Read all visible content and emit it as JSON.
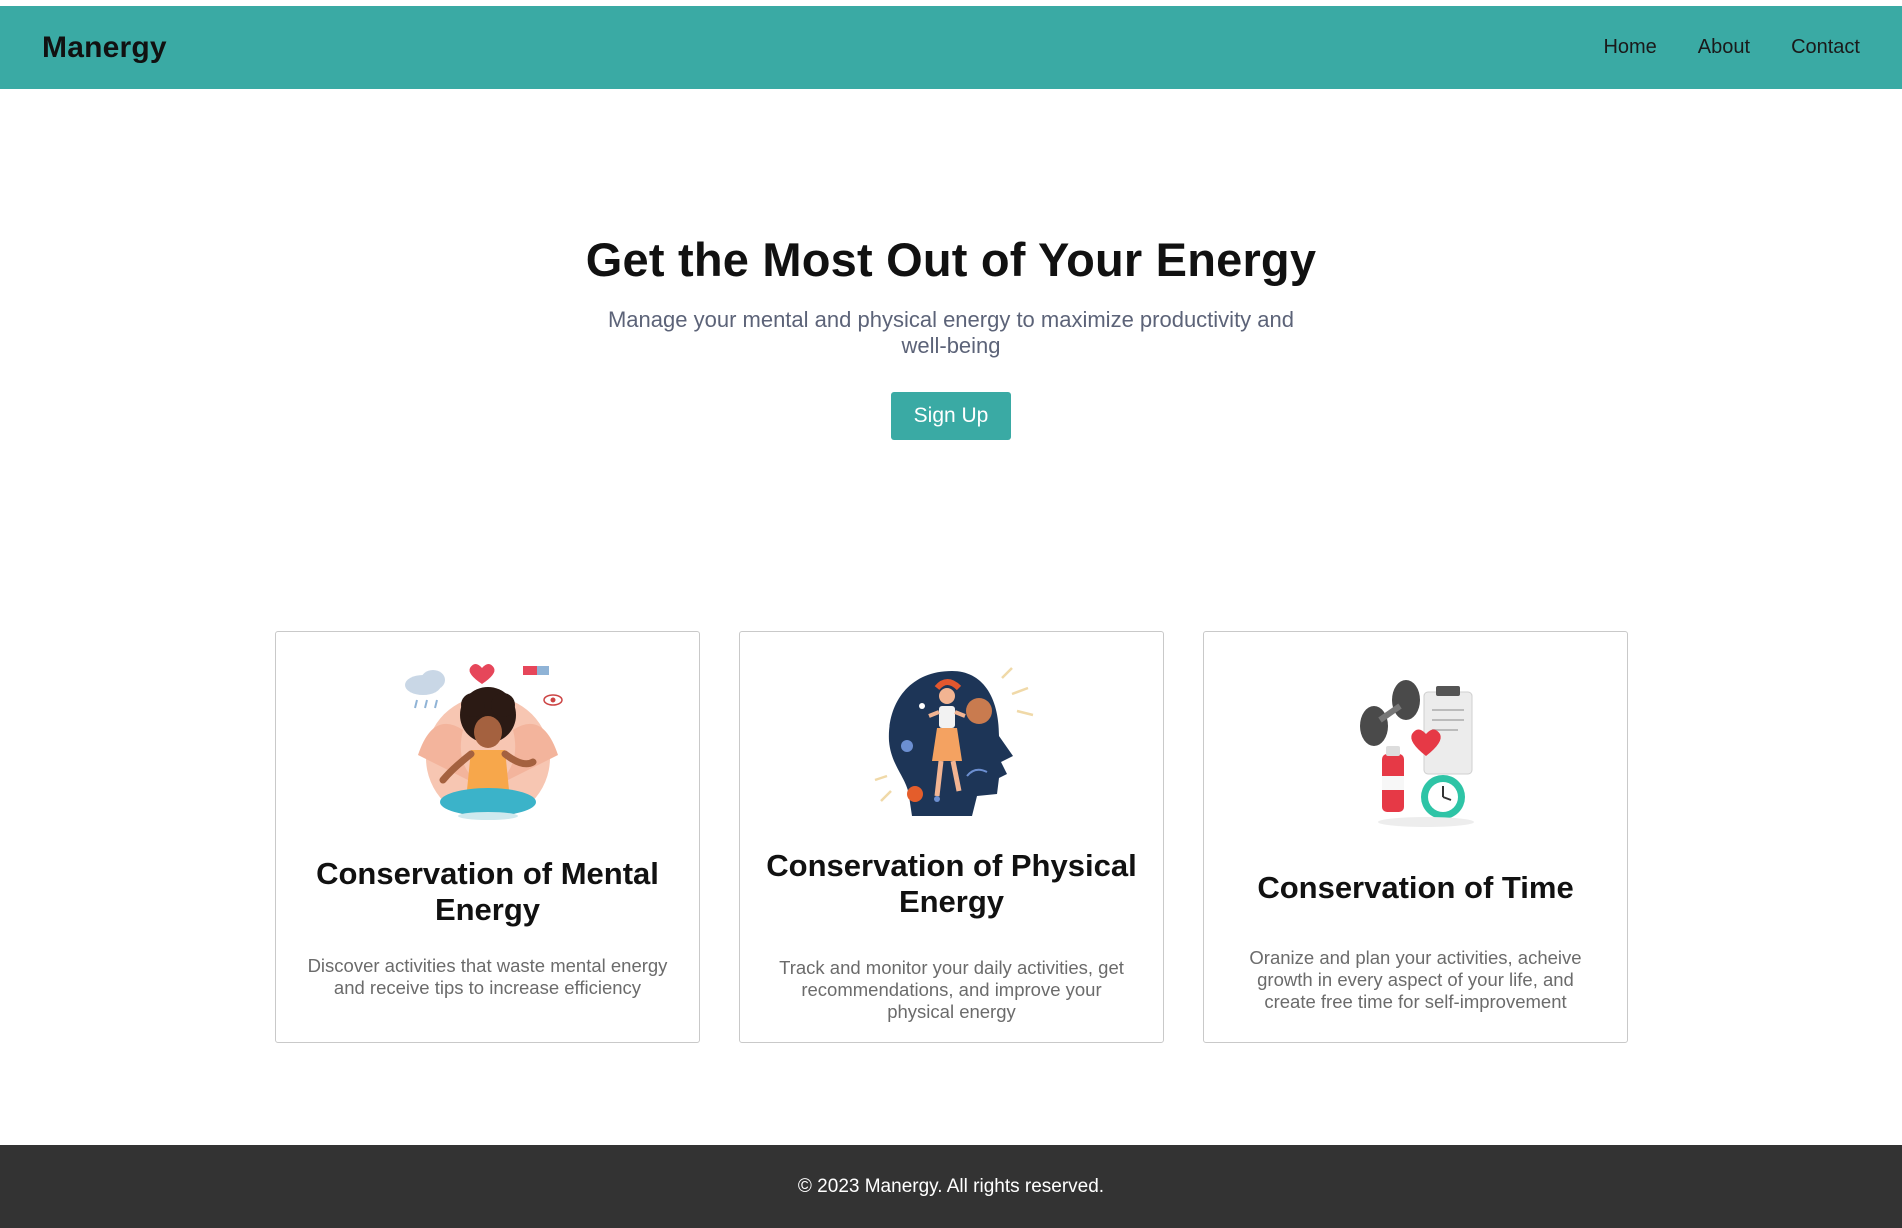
{
  "brand": "Manergy",
  "nav": {
    "home": "Home",
    "about": "About",
    "contact": "Contact"
  },
  "hero": {
    "title": "Get the Most Out of Your Energy",
    "subtitle": "Manage your mental and physical energy to maximize productivity and well-being",
    "cta": "Sign Up"
  },
  "cards": [
    {
      "title": "Conservation of Mental Energy",
      "text": "Discover activities that waste mental energy and receive tips to increase efficiency",
      "icon": "meditation-illustration-icon"
    },
    {
      "title": "Conservation of Physical Energy",
      "text": "Track and monitor your daily activities, get recommendations, and improve your physical energy",
      "icon": "head-silhouette-illustration-icon"
    },
    {
      "title": "Conservation of Time",
      "text": "Oranize and plan your activities, acheive growth in every aspect of your life, and create free time for self-improvement",
      "icon": "fitness-clock-illustration-icon"
    }
  ],
  "footer": {
    "text": "© 2023 Manergy. All rights reserved."
  },
  "colors": {
    "accent": "#3aaaa4",
    "footer": "#333333",
    "subtitle": "#5c6378"
  }
}
